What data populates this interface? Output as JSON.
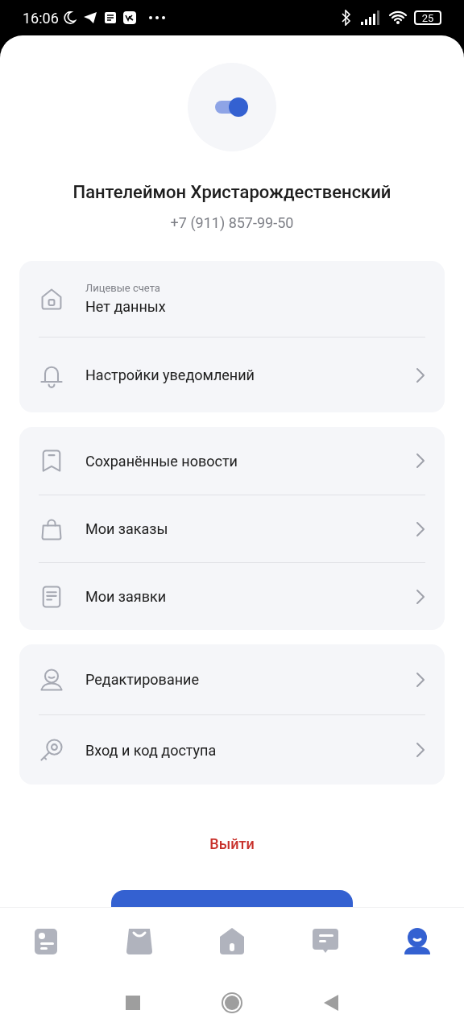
{
  "status_bar": {
    "time": "16:06",
    "battery": "25"
  },
  "profile": {
    "name": "Пантелеймон Христарождественский",
    "phone": "+7 (911) 857-99-50"
  },
  "groups": [
    {
      "items": [
        {
          "kind": "info",
          "caption": "Лицевые счета",
          "label": "Нет данных"
        },
        {
          "kind": "link",
          "label": "Настройки уведомлений"
        }
      ]
    },
    {
      "items": [
        {
          "kind": "link",
          "label": "Сохранённые новости"
        },
        {
          "kind": "link",
          "label": "Мои заказы"
        },
        {
          "kind": "link",
          "label": "Мои заявки"
        }
      ]
    },
    {
      "items": [
        {
          "kind": "link",
          "label": "Редактирование"
        },
        {
          "kind": "link",
          "label": "Вход и код доступа"
        }
      ]
    }
  ],
  "logout": "Выйти",
  "tab_bar": [
    {
      "selected": false
    },
    {
      "selected": false
    },
    {
      "selected": false
    },
    {
      "selected": false
    },
    {
      "selected": true
    }
  ]
}
